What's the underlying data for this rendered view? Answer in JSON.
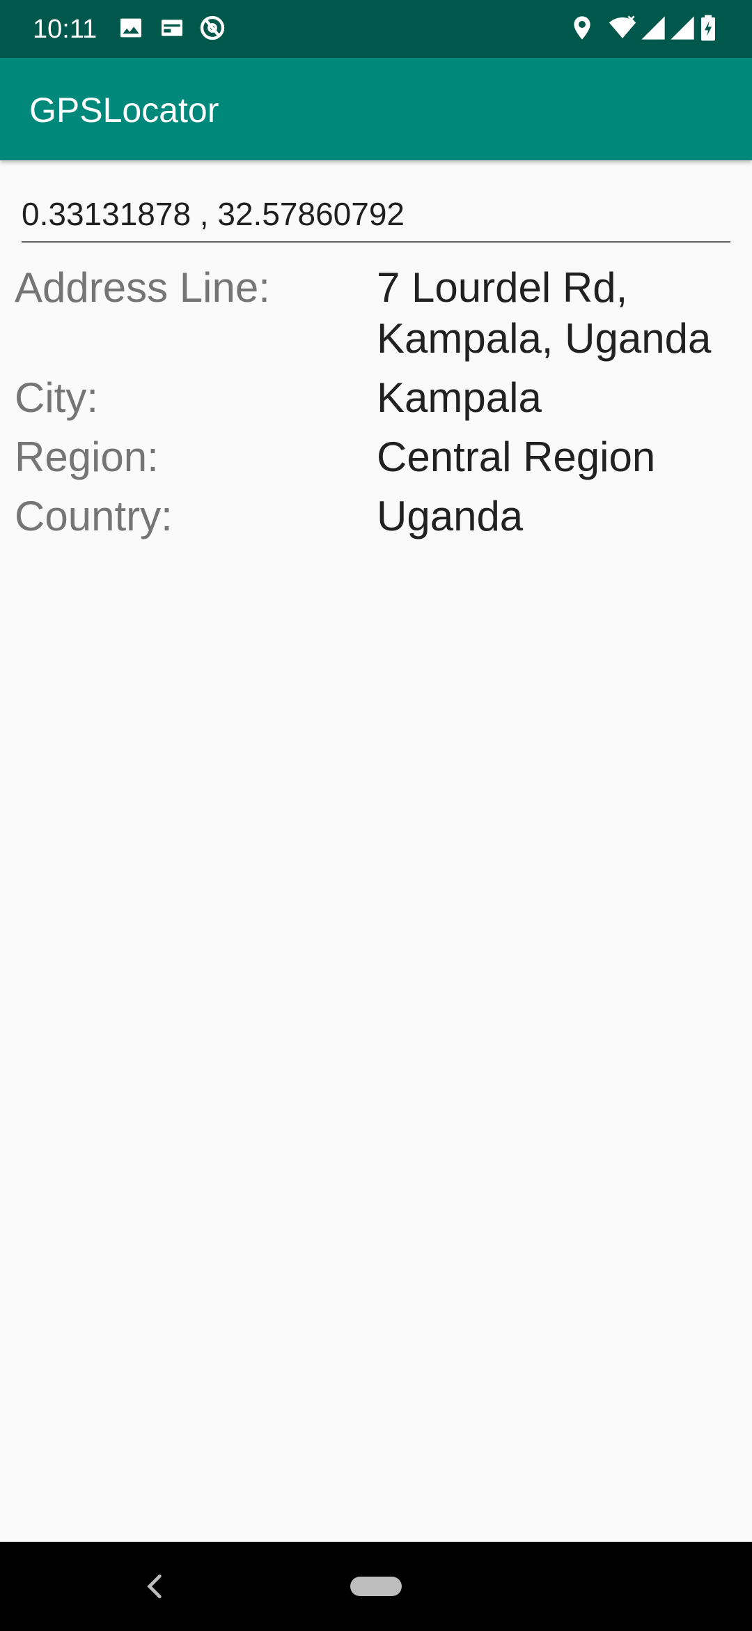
{
  "status_bar": {
    "time": "10:11",
    "left_icons": [
      "image-icon",
      "sim-card-icon",
      "at-sign-icon"
    ],
    "right_icons": [
      "location-pin-icon",
      "wifi-icon",
      "signal-icon",
      "signal-icon",
      "battery-charging-icon"
    ]
  },
  "app_bar": {
    "title": "GPSLocator",
    "color": "#00897b",
    "status_color": "#00574b"
  },
  "coordinates": {
    "value": "0.33131878 , 32.57860792"
  },
  "info": {
    "address": {
      "label": "Address Line:",
      "value": "7 Lourdel Rd,\nKampala, Uganda"
    },
    "city": {
      "label": "City:",
      "value": "Kampala"
    },
    "region": {
      "label": "Region:",
      "value": "Central Region"
    },
    "country": {
      "label": "Country:",
      "value": "Uganda"
    }
  }
}
